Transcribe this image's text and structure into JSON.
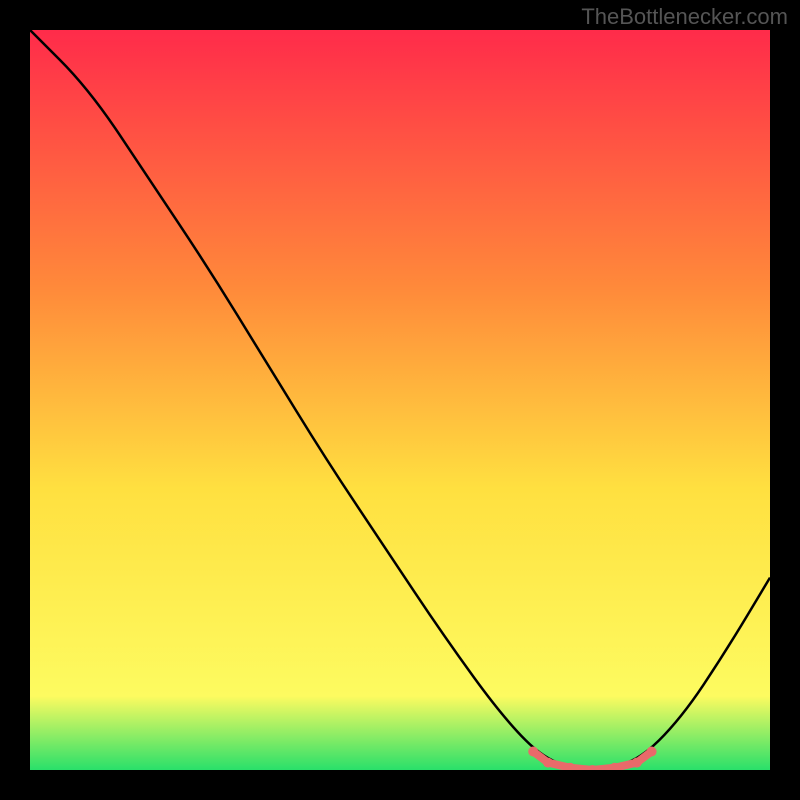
{
  "watermark": "TheBottlenecker.com",
  "chart_data": {
    "type": "line",
    "title": "",
    "xlabel": "",
    "ylabel": "",
    "xlim": [
      0,
      100
    ],
    "ylim": [
      0,
      100
    ],
    "background_gradient": {
      "top": "#ff2b4a",
      "mid_upper": "#ff8a3a",
      "mid": "#ffe040",
      "mid_lower": "#fdfb60",
      "bottom": "#29e06a"
    },
    "main_curve": {
      "name": "bottleneck-curve",
      "color": "#000000",
      "points": [
        {
          "x": 0,
          "y": 100
        },
        {
          "x": 8,
          "y": 92
        },
        {
          "x": 16,
          "y": 80
        },
        {
          "x": 24,
          "y": 68
        },
        {
          "x": 32,
          "y": 55
        },
        {
          "x": 40,
          "y": 42
        },
        {
          "x": 48,
          "y": 30
        },
        {
          "x": 56,
          "y": 18
        },
        {
          "x": 64,
          "y": 7
        },
        {
          "x": 70,
          "y": 1
        },
        {
          "x": 76,
          "y": 0
        },
        {
          "x": 82,
          "y": 1
        },
        {
          "x": 88,
          "y": 7
        },
        {
          "x": 94,
          "y": 16
        },
        {
          "x": 100,
          "y": 26
        }
      ]
    },
    "highlight_segment": {
      "color": "#e96a6a",
      "points": [
        {
          "x": 68,
          "y": 2.5
        },
        {
          "x": 70,
          "y": 1
        },
        {
          "x": 73,
          "y": 0.3
        },
        {
          "x": 76,
          "y": 0
        },
        {
          "x": 79,
          "y": 0.3
        },
        {
          "x": 82,
          "y": 1
        },
        {
          "x": 84,
          "y": 2.5
        }
      ]
    }
  }
}
